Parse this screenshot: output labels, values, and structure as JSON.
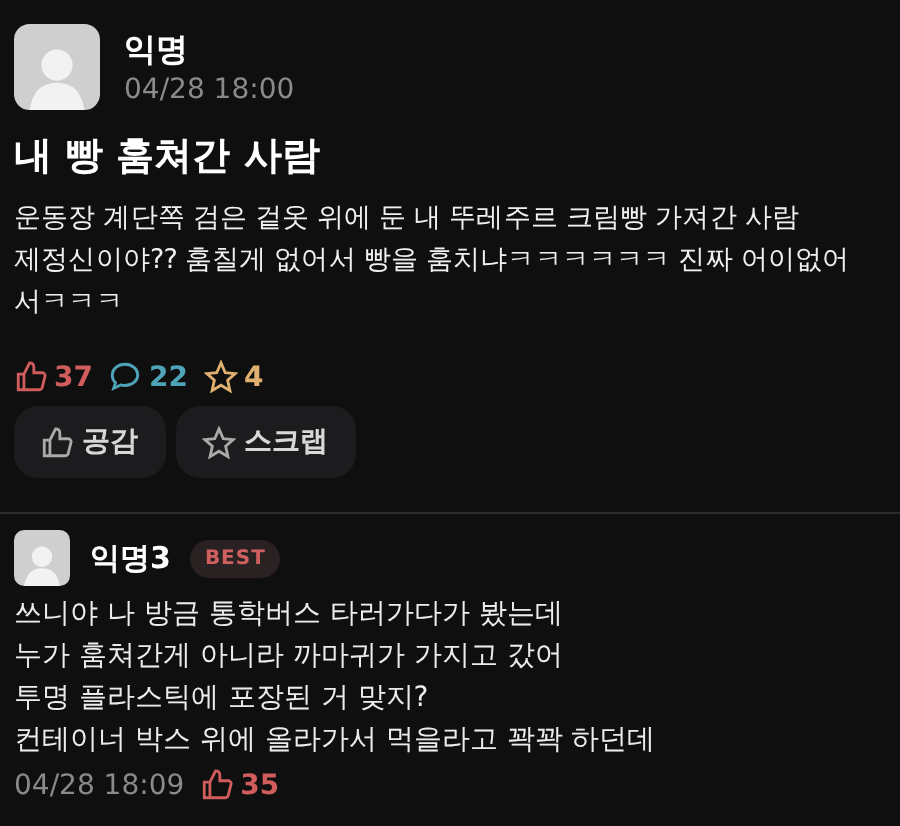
{
  "post": {
    "author": "익명",
    "time": "04/28 18:00",
    "title": "내 빵 훔쳐간 사람",
    "body_lines": [
      "운동장 계단쪽 검은 겉옷 위에 둔 내 뚜레주르 크림빵 가져간 사람",
      "제정신이야?? 훔칠게 없어서 빵을 훔치냐ㅋㅋㅋㅋㅋㅋ 진짜 어이없어",
      "서ㅋㅋㅋ"
    ],
    "stats": {
      "likes": "37",
      "comments": "22",
      "scraps": "4"
    },
    "buttons": [
      {
        "kind": "like",
        "label": "공감"
      },
      {
        "kind": "scrap",
        "label": "스크랩"
      }
    ]
  },
  "comment": {
    "author": "익명3",
    "badge": "BEST",
    "lines": [
      "쓰니야 나 방금 통학버스 타러가다가 봤는데",
      "누가 훔쳐간게 아니라 까마귀가 가지고 갔어",
      "투명 플라스틱에 포장된 거 맞지?",
      "컨테이너 박스 위에 올라가서 먹을라고 꽉꽉 하던데"
    ],
    "time": "04/28 18:09",
    "likes": "35"
  }
}
